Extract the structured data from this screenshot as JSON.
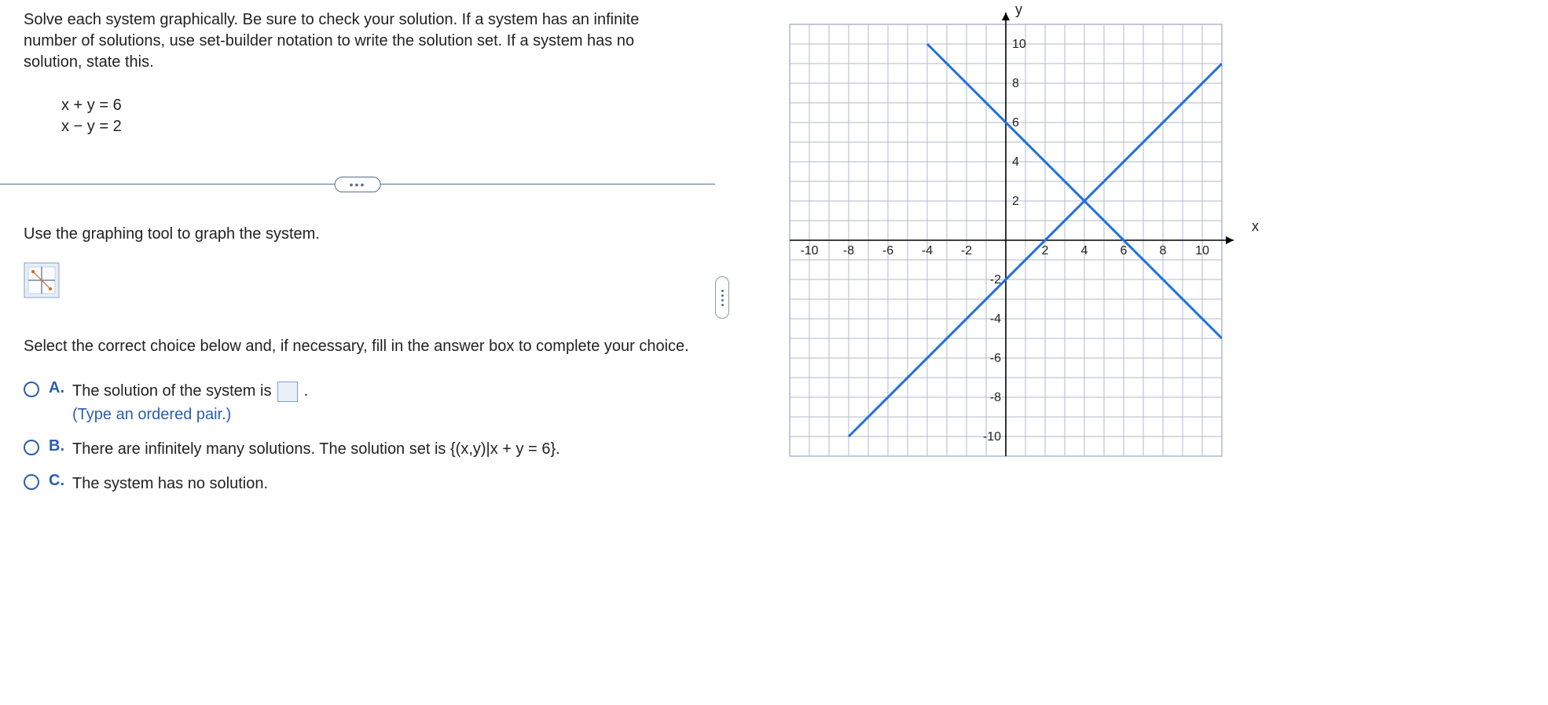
{
  "instructions": "Solve each system graphically. Be sure to check your solution. If a system has an infinite number of solutions, use set-builder notation to write the solution set. If a system has no solution, state this.",
  "equations": {
    "line1": "x + y = 6",
    "line2": "x − y = 2"
  },
  "prompt2": "Use the graphing tool to graph the system.",
  "prompt3": "Select the correct choice below and, if necessary, fill in the answer box to complete your choice.",
  "choices": {
    "a": {
      "label": "A.",
      "text_before": "The solution of the system is ",
      "text_after": ".",
      "hint": "(Type an ordered pair.)"
    },
    "b": {
      "label": "B.",
      "text": "There are infinitely many solutions. The solution set is {(x,y)|x + y = 6}."
    },
    "c": {
      "label": "C.",
      "text": "The system has no solution."
    }
  },
  "axes": {
    "y_label": "y",
    "x_label": "x",
    "x_ticks": [
      "-10",
      "-8",
      "-6",
      "-4",
      "-2",
      "2",
      "4",
      "6",
      "8",
      "10"
    ],
    "y_ticks_pos": [
      "10",
      "8",
      "6",
      "4",
      "2"
    ],
    "y_ticks_neg": [
      "-2",
      "-4",
      "-6",
      "-8",
      "-10"
    ]
  },
  "chart_data": {
    "type": "line",
    "title": "",
    "xlabel": "x",
    "ylabel": "y",
    "xlim": [
      -11,
      11
    ],
    "ylim": [
      -11,
      11
    ],
    "grid": true,
    "series": [
      {
        "name": "x + y = 6",
        "points": [
          [
            -4,
            10
          ],
          [
            11,
            -5
          ]
        ]
      },
      {
        "name": "x - y = 2",
        "points": [
          [
            -8,
            -10
          ],
          [
            11,
            9
          ]
        ]
      }
    ],
    "intersection": [
      4,
      2
    ]
  }
}
